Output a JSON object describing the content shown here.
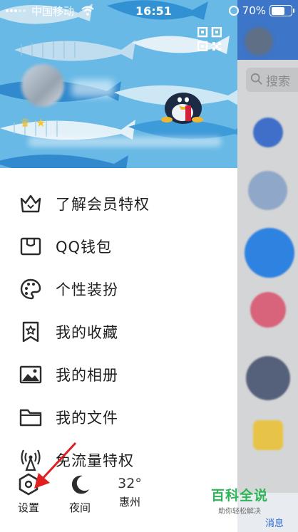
{
  "status_bar": {
    "carrier": "中国移动",
    "time": "16:51",
    "battery": "70%",
    "battery_level": 0.7
  },
  "header": {
    "qr_icon": "qr-code-icon",
    "badges": [
      "crown-icon",
      "star-icon"
    ]
  },
  "menu": {
    "items": [
      {
        "label": "了解会员特权",
        "icon": "crown-outline-icon"
      },
      {
        "label": "QQ钱包",
        "icon": "wallet-icon"
      },
      {
        "label": "个性装扮",
        "icon": "palette-icon"
      },
      {
        "label": "我的收藏",
        "icon": "bookmark-star-icon"
      },
      {
        "label": "我的相册",
        "icon": "image-icon"
      },
      {
        "label": "我的文件",
        "icon": "folder-icon"
      },
      {
        "label": "免流量特权",
        "icon": "antenna-icon"
      }
    ]
  },
  "bottom": {
    "settings_label": "设置",
    "night_label": "夜间",
    "weather_temp": "32°",
    "weather_city": "惠州"
  },
  "watermark": {
    "title": "百科全说",
    "subtitle": "助你轻松解决"
  },
  "side_panel": {
    "search_text": "搜索",
    "bottom_tab": "消息"
  },
  "colors": {
    "header_bg": "#68b9e6",
    "accent_blue": "#3d75c9",
    "watermark_green": "#2eb556",
    "arrow_red": "#e02020"
  }
}
